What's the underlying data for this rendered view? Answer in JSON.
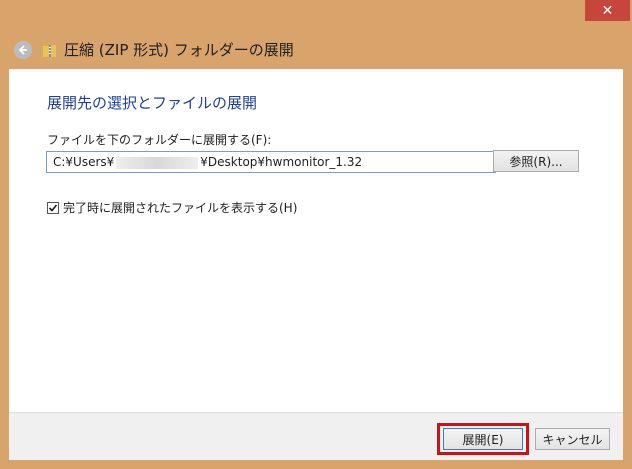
{
  "window": {
    "title": "圧縮 (ZIP 形式) フォルダーの展開",
    "close_glyph": "✕",
    "back_icon": "back-arrow-icon",
    "title_icon": "zip-folder-icon"
  },
  "main": {
    "heading": "展開先の選択とファイルの展開",
    "path_label": "ファイルを下のフォルダーに展開する(F):",
    "path_value_prefix": "C:¥Users¥",
    "path_value_suffix": "¥Desktop¥hwmonitor_1.32",
    "browse_label": "参照(R)...",
    "show_files_label": "完了時に展開されたファイルを表示する(H)",
    "show_files_checked": true
  },
  "footer": {
    "extract_label": "展開(E)",
    "cancel_label": "キャンセル"
  },
  "colors": {
    "frame": "#d8a46c",
    "close_button": "#c7463b",
    "heading": "#1f3f9a",
    "highlight": "#c8131a"
  }
}
